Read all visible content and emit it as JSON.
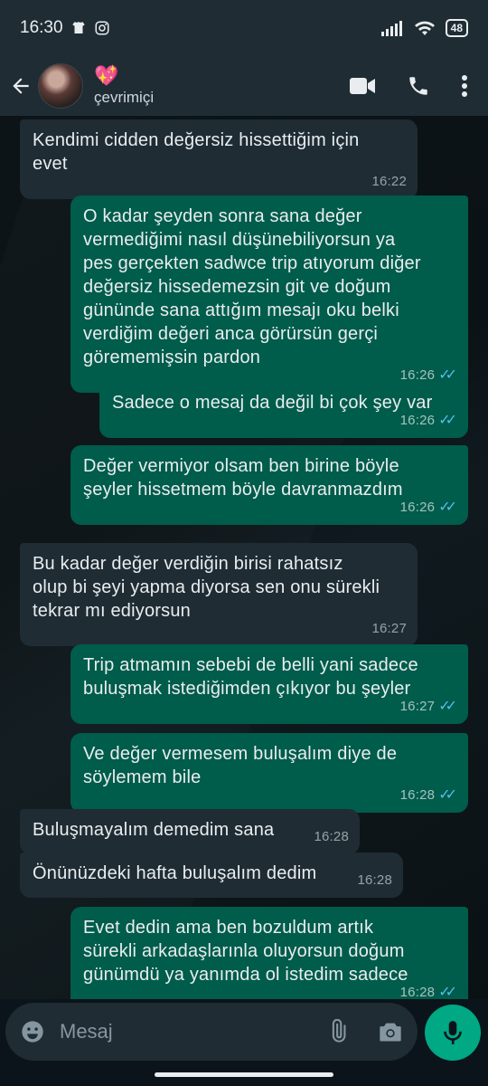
{
  "status_bar": {
    "time": "16:30",
    "battery": "48"
  },
  "header": {
    "contact_emoji": "💖",
    "subtitle": "çevrimiçi"
  },
  "messages": [
    {
      "dir": "in",
      "text": "Kendimi cidden değersiz hissettiğim için\nevet",
      "time": "16:22",
      "read": false
    },
    {
      "dir": "out",
      "text": "O kadar şeyden sonra sana değer\nvermediğimi nasıl düşünebiliyorsun ya\npes gerçekten sadwce trip atıyorum diğer\ndeğersiz hissedemezsin git ve doğum\ngününde sana attığım mesajı oku belki\nverdiğim değeri anca görürsün gerçi\ngörememişsin pardon",
      "time": "16:26",
      "read": true
    },
    {
      "dir": "out",
      "text": "Sadece o mesaj da değil bi çok şey var",
      "time": "16:26",
      "read": true
    },
    {
      "dir": "out",
      "text": "Değer vermiyor olsam ben birine böyle\nşeyler hissetmem böyle davranmazdım",
      "time": "16:26",
      "read": true
    },
    {
      "dir": "in",
      "text": "Bu kadar değer verdiğin birisi rahatsız\nolup bi şeyi yapma diyorsa sen onu sürekli\ntekrar mı ediyorsun",
      "time": "16:27",
      "read": false
    },
    {
      "dir": "out",
      "text": "Trip atmamın sebebi de belli yani sadece\nbuluşmak istediğimden çıkıyor bu şeyler",
      "time": "16:27",
      "read": true
    },
    {
      "dir": "out",
      "text": "Ve değer vermesem buluşalım diye de\nsöylemem bile",
      "time": "16:28",
      "read": true
    },
    {
      "dir": "in",
      "text": "Buluşmayalım demedim sana",
      "time": "16:28",
      "read": false
    },
    {
      "dir": "in",
      "text": "Önünüzdeki hafta buluşalım dedim",
      "time": "16:28",
      "read": false
    },
    {
      "dir": "out",
      "text": "Evet dedin ama ben bozuldum artık\nsürekli arkadaşlarınla oluyorsun doğum\ngünümdü ya yanımda ol istedim sadece",
      "time": "16:28",
      "read": true
    }
  ],
  "input": {
    "placeholder": "Mesaj"
  },
  "colors": {
    "bg": "#0b141a",
    "bar": "#1f2c34",
    "outgoing": "#005c4b",
    "incoming": "#1f2c34",
    "accent": "#00a884",
    "tick": "#53bdeb"
  },
  "icons": [
    "back-arrow-icon",
    "video-call-icon",
    "phone-icon",
    "more-vert-icon",
    "emoji-icon",
    "attach-icon",
    "camera-icon",
    "mic-icon"
  ]
}
